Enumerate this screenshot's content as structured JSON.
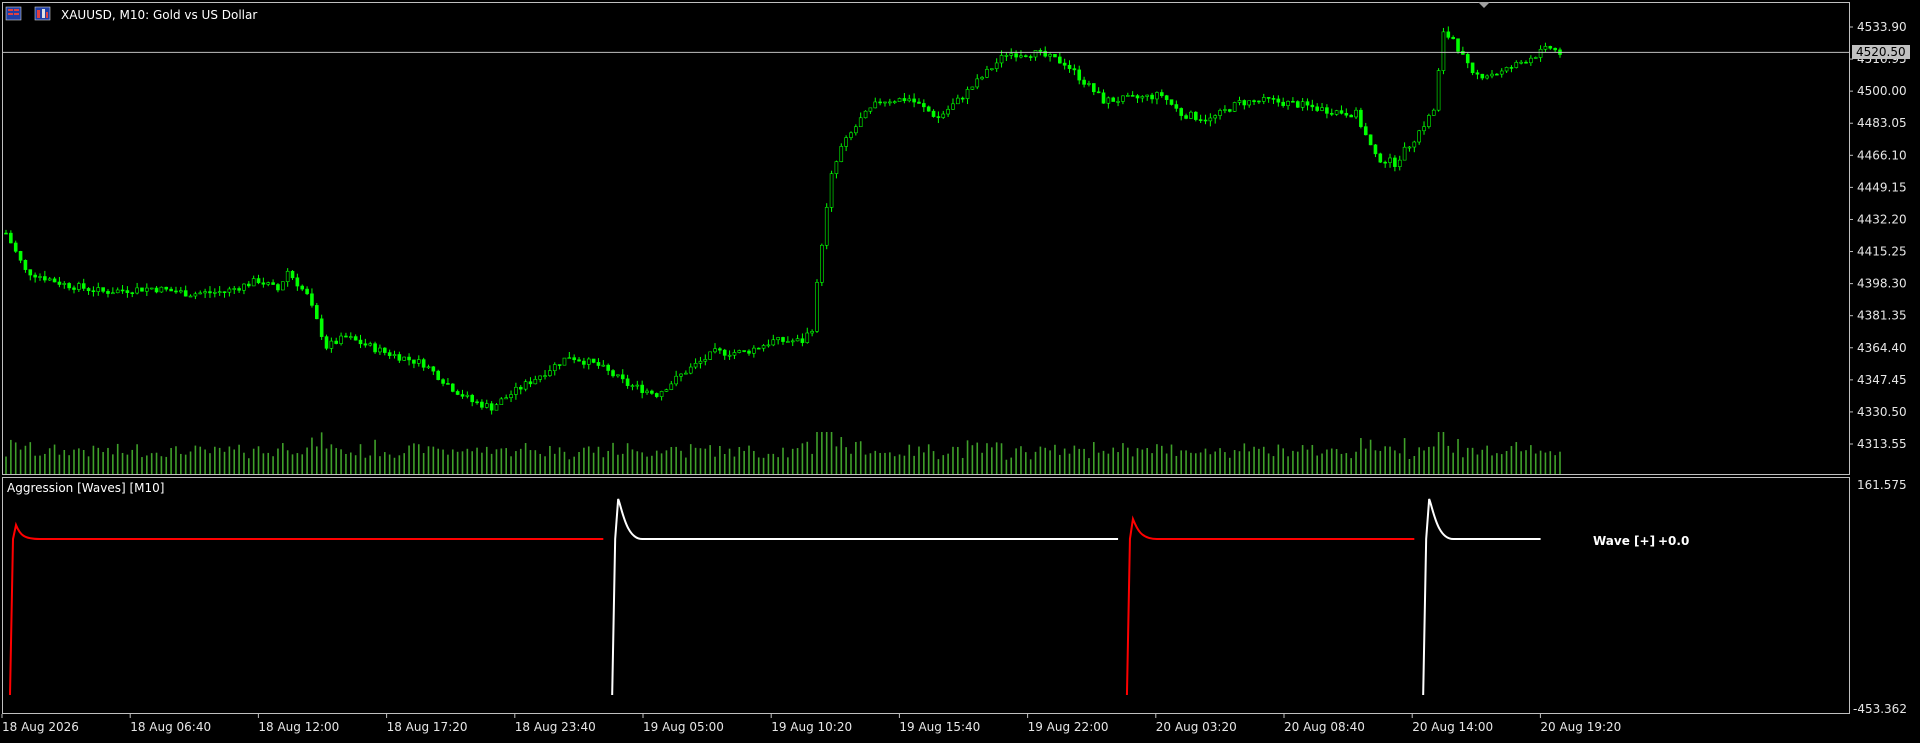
{
  "window": {
    "symbol_title": "XAUUSD, M10:  Gold vs US Dollar",
    "icons": [
      "terminal-menu-icon",
      "chart-type-icon"
    ]
  },
  "price_axis": {
    "labels": [
      "4533.90",
      "4516.95",
      "4500.00",
      "4483.05",
      "4466.10",
      "4449.15",
      "4432.20",
      "4415.25",
      "4398.30",
      "4381.35",
      "4364.40",
      "4347.45",
      "4330.50",
      "4313.55"
    ],
    "current_price": "4520.50",
    "bid_line_color": "#c0c0c0",
    "current_price_bg": "#c0c0c0"
  },
  "indicator": {
    "title": "Aggression [Waves] [M10]",
    "axis_top": "161.575",
    "axis_bottom": "-453.362",
    "wave_label": "Wave [+]",
    "wave_value": "+0.0"
  },
  "time_axis": {
    "labels": [
      "18 Aug 2026",
      "18 Aug 06:40",
      "18 Aug 12:00",
      "18 Aug 17:20",
      "18 Aug 23:40",
      "19 Aug 05:00",
      "19 Aug 10:20",
      "19 Aug 15:40",
      "19 Aug 22:00",
      "20 Aug 03:20",
      "20 Aug 08:40",
      "20 Aug 14:00",
      "20 Aug 19:20"
    ]
  },
  "colors": {
    "background": "#000000",
    "candle": "#00ff00",
    "volume": "#3fa02a",
    "wave_negative": "#ff0000",
    "wave_positive": "#ffffff",
    "grid_border": "#bfbfbf"
  },
  "chart_data": {
    "type": "line",
    "price_keypoints": [
      [
        0,
        4425
      ],
      [
        4,
        4405
      ],
      [
        12,
        4398
      ],
      [
        20,
        4394
      ],
      [
        30,
        4396
      ],
      [
        38,
        4393
      ],
      [
        45,
        4394
      ],
      [
        52,
        4400
      ],
      [
        56,
        4395
      ],
      [
        58,
        4405
      ],
      [
        62,
        4392
      ],
      [
        66,
        4365
      ],
      [
        70,
        4370
      ],
      [
        78,
        4362
      ],
      [
        86,
        4356
      ],
      [
        92,
        4343
      ],
      [
        96,
        4336
      ],
      [
        100,
        4333
      ],
      [
        104,
        4340
      ],
      [
        110,
        4350
      ],
      [
        116,
        4360
      ],
      [
        122,
        4355
      ],
      [
        128,
        4345
      ],
      [
        134,
        4340
      ],
      [
        140,
        4352
      ],
      [
        146,
        4362
      ],
      [
        152,
        4362
      ],
      [
        158,
        4368
      ],
      [
        164,
        4368
      ],
      [
        166,
        4375
      ],
      [
        168,
        4420
      ],
      [
        170,
        4455
      ],
      [
        172,
        4470
      ],
      [
        176,
        4485
      ],
      [
        180,
        4495
      ],
      [
        186,
        4496
      ],
      [
        192,
        4486
      ],
      [
        196,
        4495
      ],
      [
        202,
        4510
      ],
      [
        206,
        4520
      ],
      [
        212,
        4520
      ],
      [
        218,
        4515
      ],
      [
        222,
        4505
      ],
      [
        226,
        4495
      ],
      [
        232,
        4496
      ],
      [
        238,
        4498
      ],
      [
        242,
        4488
      ],
      [
        248,
        4485
      ],
      [
        254,
        4494
      ],
      [
        260,
        4495
      ],
      [
        266,
        4493
      ],
      [
        272,
        4490
      ],
      [
        278,
        4488
      ],
      [
        282,
        4465
      ],
      [
        286,
        4462
      ],
      [
        290,
        4475
      ],
      [
        294,
        4490
      ],
      [
        296,
        4530
      ],
      [
        298,
        4528
      ],
      [
        302,
        4508
      ],
      [
        308,
        4510
      ],
      [
        314,
        4518
      ],
      [
        318,
        4523
      ],
      [
        320,
        4520
      ]
    ],
    "wave_spikes": [
      {
        "start_bar": 0,
        "end_bar": 123,
        "peak": 120,
        "base": 0,
        "color": "negative"
      },
      {
        "start_bar": 124,
        "end_bar": 229,
        "peak": 240,
        "base": 0,
        "color": "positive"
      },
      {
        "start_bar": 230,
        "end_bar": 290,
        "peak": 280,
        "base": 0,
        "color": "negative"
      },
      {
        "start_bar": 291,
        "end_bar": 316,
        "peak": 270,
        "base": 0,
        "color": "positive"
      }
    ],
    "ylim": [
      4313.55,
      4533.9
    ]
  }
}
